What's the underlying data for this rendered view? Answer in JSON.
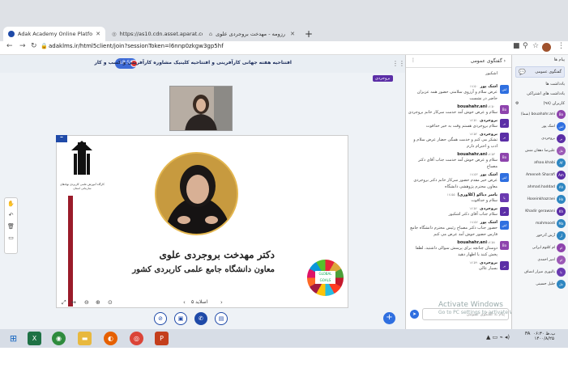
{
  "browser": {
    "tabs": [
      {
        "title": "Adak Academy Online Platfo",
        "close": "✕"
      },
      {
        "title": "https://as10.cdn.asset.aparat.com",
        "close": "✕"
      },
      {
        "title": "رزومه - مهدخت بروجردی علوی",
        "close": "✕"
      }
    ],
    "new_tab": "+",
    "url": "adaklms.ir/html5client/join?sessionToken=l6nnp0zkgw3gp5hf"
  },
  "app": {
    "session_title": "افتتاحیه هفته جهانی کارآفرینی و افتتاحیه کلینیک مشاوره کارآفرینی و کسب و کار",
    "timer": "18:59",
    "presenter_badge": "بروجردی"
  },
  "slide": {
    "name": "دکتر مهدخت بروجردی علوی",
    "role": "معاون دانشگاه جامع علمی کاربردی کشور",
    "logo_text": "کارگاه آموزش علمی کاربردی نهادهای سازمانی استان",
    "globe_text": "GLOBAL GOALS",
    "pager": "اسلاید ۵"
  },
  "chat": {
    "title": "گفتگوی عمومی",
    "first_line": "اشکبور",
    "input_placeholder": "پیام به گفتگوی عمومی",
    "messages": [
      {
        "avatar": "اش",
        "color": "#2f6fe0",
        "name": "اشک پور",
        "time": "۱۸:۵۰",
        "text": "عرض سلام و آرزوی سلامتی حضور همه عزیزان حاضر در نشست"
      },
      {
        "avatar": "Bo",
        "color": "#8e44ad",
        "name": "bouahahr.ani",
        "time": "۱۸:۵۰",
        "text": "سلام و عرض خوش آمد خدمت سرکار خانم بروجردی"
      },
      {
        "avatar": "بر",
        "color": "#5b2ea6",
        "name": "بروجردی",
        "time": "۱۸:۵۱",
        "text": "سلام بروجردی هستم وقت به خیر خداقوت"
      },
      {
        "avatar": "بر",
        "color": "#5b2ea6",
        "name": "بروجردی",
        "time": "۱۸:۵۲",
        "text": "تشکر می کنم و خدمت همگی حضار عرض سلام و ادب و احترام دارم"
      },
      {
        "avatar": "Bo",
        "color": "#8e44ad",
        "name": "bouahahr.ani",
        "time": "۱۸:۵۳",
        "text": "سلام و عرض خوش آمد خدمت جناب آقای دکتر مصباح"
      },
      {
        "avatar": "اش",
        "color": "#2f6fe0",
        "name": "اشک پور",
        "time": "۱۸:۵۳",
        "text": "عرض خیر مقدم حضور سرکار خانم دکتر بروجردی معاون محترم پژوهشی دانشگاه"
      },
      {
        "avatar": "یا",
        "color": "#6a3ab0",
        "name": "یاسر دیاکو (کلاوری)",
        "time": "۱۸:۵۵",
        "text": "سلام و خداقوت"
      },
      {
        "avatar": "بر",
        "color": "#5b2ea6",
        "name": "بروجردی",
        "time": "۱۸:۵۶",
        "text": "سلام جناب آقای دکتر اشکبور"
      },
      {
        "avatar": "اش",
        "color": "#2f6fe0",
        "name": "اشک پور",
        "time": "۱۸:۵۷",
        "text": "حضور جناب دکتر مصباح رئیس محترم دانشگاه جامع فارس حضور خوش آمد عرض می کنم"
      },
      {
        "avatar": "Bo",
        "color": "#8e44ad",
        "name": "bouahahr.ani",
        "time": "۱۸:۵۸",
        "text": "دوستان چنانچه برای پرسش سوالی داشتید، لطفا پخش کنند یا اظهار دهید"
      },
      {
        "avatar": "بر",
        "color": "#5b2ea6",
        "name": "بروجردی",
        "time": "۱۸:۵۹",
        "text": "بسیار عالی"
      }
    ],
    "activate_title": "Activate Windows",
    "activate_sub": "Go to PC settings to activate Windows."
  },
  "sidebar": {
    "messages_header": "پیام ها",
    "public_chat_button": "گفتگوی عمومی",
    "notes_header": "یادداشت ها",
    "shared_notes": "یادداشت های اشتراکی",
    "users_header": "کاربران (۹۸)",
    "users": [
      {
        "name": "bouahahr.ani (شما)",
        "avatar": "Bo",
        "color": "#8e44ad"
      },
      {
        "name": "اشک پور",
        "avatar": "اش",
        "color": "#2f6fe0"
      },
      {
        "name": "بروجردی",
        "avatar": "بر",
        "color": "#5b2ea6"
      },
      {
        "name": "علیرضا دهقان منش",
        "avatar": "عل",
        "color": "#9b59b6"
      },
      {
        "name": "afsoo.khabi",
        "avatar": "Af",
        "color": "#2e86c1"
      },
      {
        "name": "Ameneh Sharafi",
        "avatar": "Am",
        "color": "#5b2ea6"
      },
      {
        "name": "ahmad.haddad",
        "avatar": "Ah",
        "color": "#2e86c1"
      },
      {
        "name": "Hoseinkhazraei",
        "avatar": "Ho",
        "color": "#2e86c1"
      },
      {
        "name": "Khadir gerawani",
        "avatar": "Kh",
        "color": "#5b2ea6"
      },
      {
        "name": "mahmoodi",
        "avatar": "Ma",
        "color": "#2e86c1"
      },
      {
        "name": "آرش آذرخور",
        "avatar": "آر",
        "color": "#2e86c1"
      },
      {
        "name": "ام کلثوم ایرانی",
        "avatar": "ام",
        "color": "#8e44ad"
      },
      {
        "name": "امیر احمدی",
        "avatar": "ام",
        "color": "#9b59b6"
      },
      {
        "name": "بالیوری میرار انصاف",
        "avatar": "با",
        "color": "#6a3ab0"
      },
      {
        "name": "جلیل حسینی",
        "avatar": "جل",
        "color": "#2e86c1"
      }
    ]
  },
  "taskbar": {
    "lang": "FA",
    "time": "۰۶:۳۰ ب.ظ",
    "date": "۱۴۰۰/۸/۲۵"
  }
}
